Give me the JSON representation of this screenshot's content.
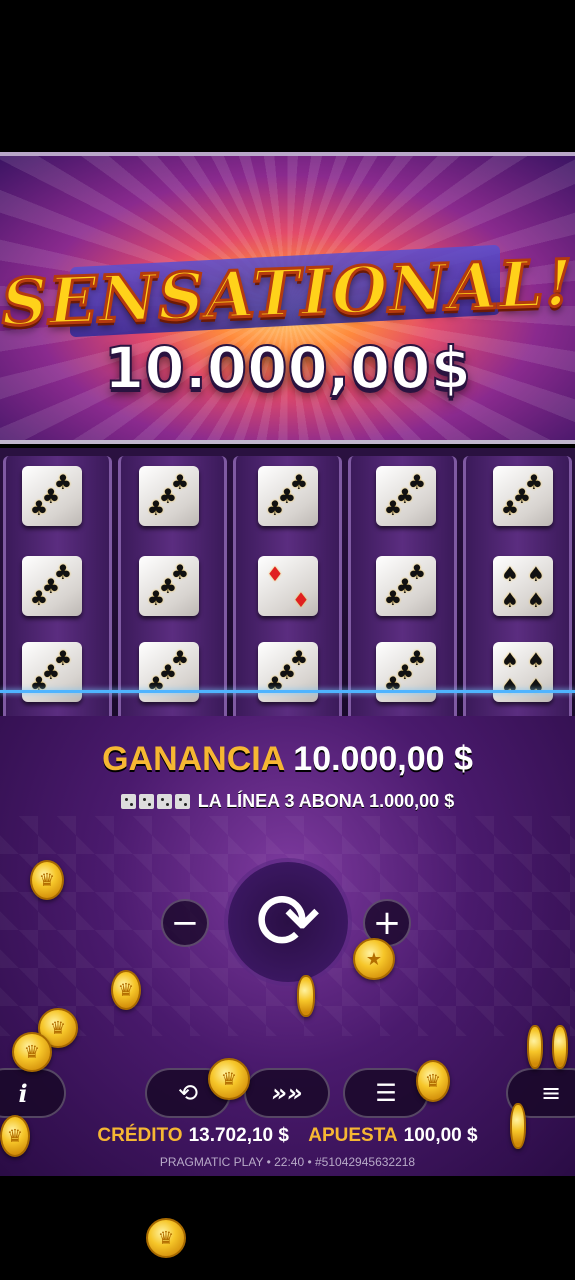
{
  "banner": {
    "title": "SENSATIONAL!",
    "amount": "10.000,00$"
  },
  "reels": {
    "columns": [
      [
        "clubs",
        "clubs",
        "clubs"
      ],
      [
        "clubs",
        "clubs",
        "clubs"
      ],
      [
        "clubs",
        "diamonds",
        "clubs"
      ],
      [
        "clubs",
        "clubs",
        "clubs"
      ],
      [
        "clubs",
        "spades",
        "spades"
      ]
    ]
  },
  "win": {
    "label": "GANANCIA",
    "value": "10.000,00 $"
  },
  "line_pay": {
    "text": "LA LÍNEA 3 ABONA 1.000,00 $"
  },
  "controls": {
    "minus": "−",
    "plus": "+",
    "spin_icon": "refresh-icon",
    "info": "i",
    "menu_icon": "hamburger-icon",
    "autoplay_icon": "autoplay-icon",
    "turbo_icon": "fast-forward-icon",
    "bet_icon": "coin-stack-icon"
  },
  "status": {
    "credit_label": "CRÉDITO",
    "credit_value": "13.702,10 $",
    "bet_label": "APUESTA",
    "bet_value": "100,00 $"
  },
  "footer": {
    "text": "PRAGMATIC PLAY • 22:40 • #51042945632218"
  },
  "colors": {
    "gold": "#f6b733",
    "payline": "#4fb4ff",
    "panel": "#4a1a6d"
  }
}
